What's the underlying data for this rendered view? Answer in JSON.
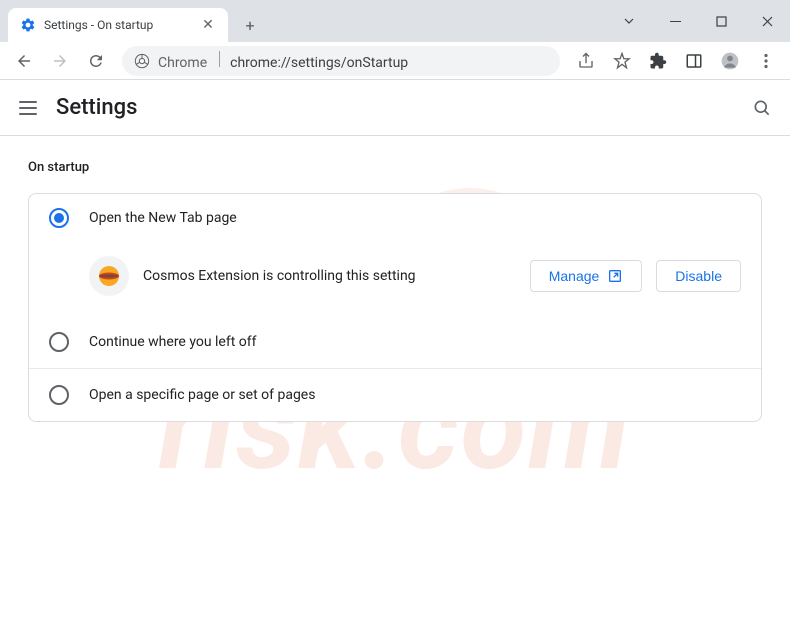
{
  "window": {
    "tab_title": "Settings - On startup"
  },
  "omnibox": {
    "prefix": "Chrome",
    "url": "chrome://settings/onStartup"
  },
  "appbar": {
    "title": "Settings"
  },
  "section": {
    "heading": "On startup",
    "options": [
      {
        "label": "Open the New Tab page",
        "selected": true
      },
      {
        "label": "Continue where you left off",
        "selected": false
      },
      {
        "label": "Open a specific page or set of pages",
        "selected": false
      }
    ],
    "extension_notice": {
      "text": "Cosmos Extension is controlling this setting",
      "manage_label": "Manage",
      "disable_label": "Disable"
    }
  },
  "watermark": {
    "text": "risk.com"
  }
}
